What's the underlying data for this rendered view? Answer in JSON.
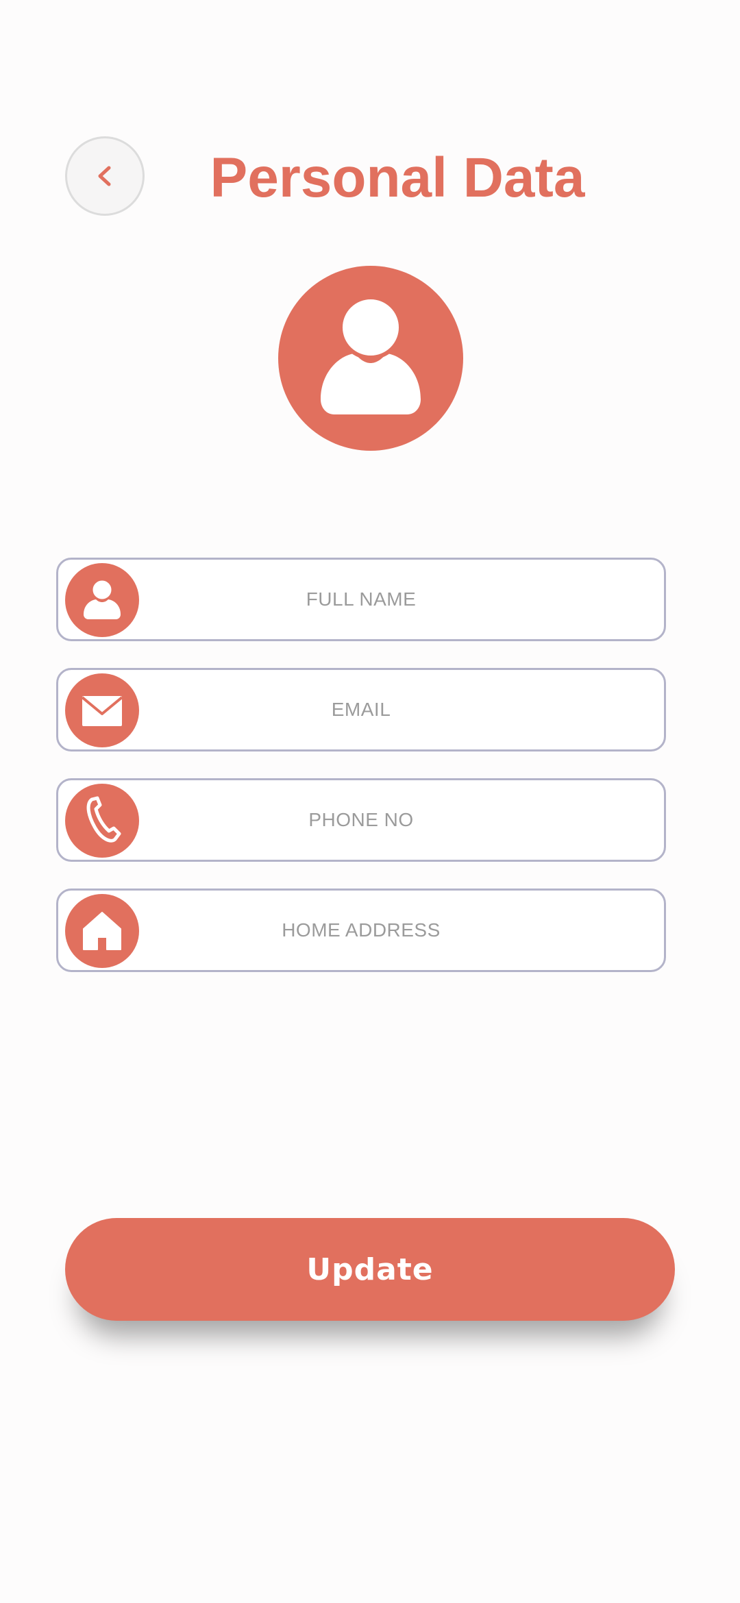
{
  "header": {
    "title": "Personal Data",
    "back_icon": "chevron-left-icon"
  },
  "profile": {
    "avatar_icon": "user-icon"
  },
  "form": {
    "fields": [
      {
        "icon": "user-icon",
        "placeholder": "FULL NAME",
        "value": ""
      },
      {
        "icon": "envelope-icon",
        "placeholder": "EMAIL",
        "value": ""
      },
      {
        "icon": "phone-icon",
        "placeholder": "PHONE NO",
        "value": ""
      },
      {
        "icon": "home-icon",
        "placeholder": "HOME ADDRESS",
        "value": ""
      }
    ]
  },
  "actions": {
    "update_label": "Update"
  },
  "colors": {
    "accent": "#e1705e",
    "field_border": "#b3b3c9",
    "placeholder": "#9b9b9b",
    "background": "#fdfcfc"
  }
}
